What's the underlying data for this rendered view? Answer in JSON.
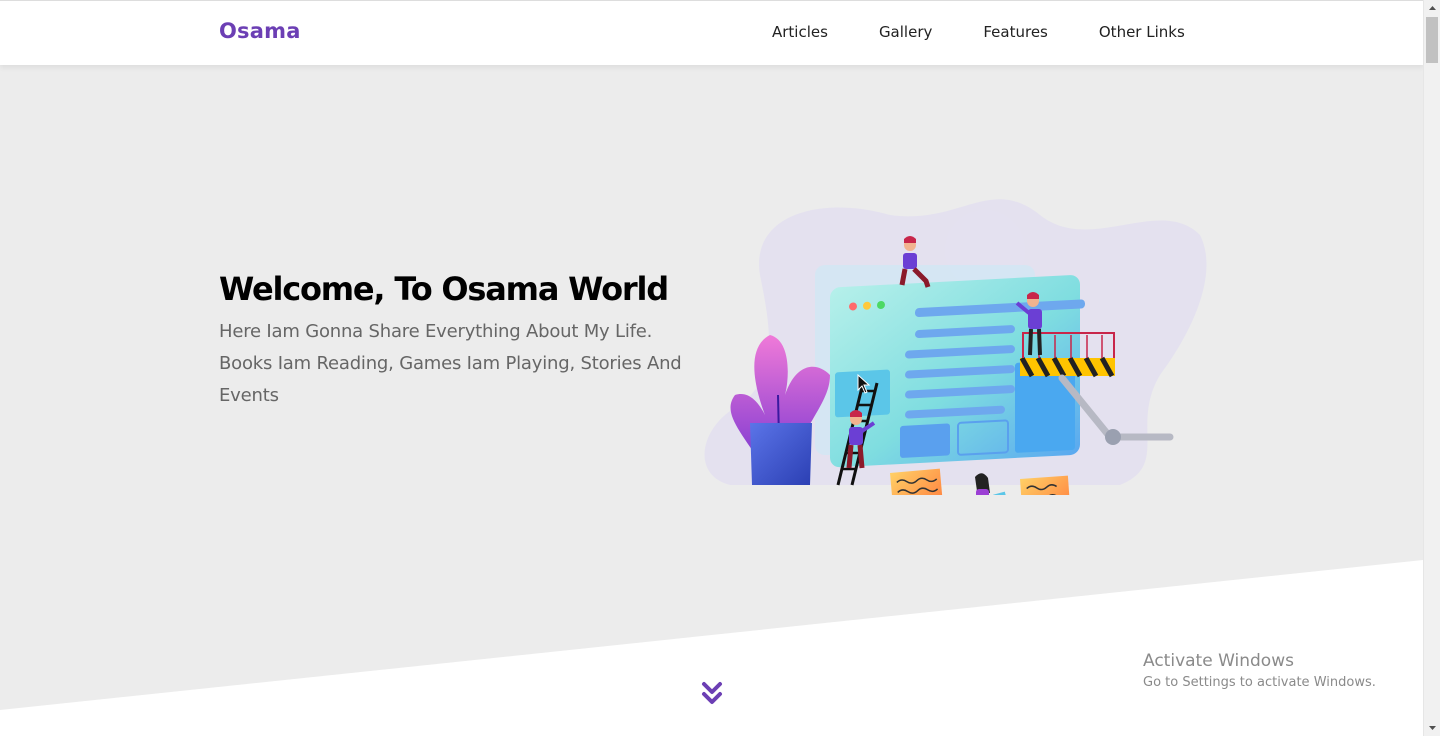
{
  "header": {
    "logo": "Osama",
    "nav": [
      "Articles",
      "Gallery",
      "Features",
      "Other Links"
    ]
  },
  "hero": {
    "title": "Welcome, To Osama World",
    "text": "Here Iam Gonna Share Everything About My Life. Books Iam Reading, Games Iam Playing, Stories And Events"
  },
  "overlay": {
    "activate_title": "Activate Windows",
    "activate_sub": "Go to Settings to activate Windows."
  },
  "colors": {
    "brand": "#6c3fb4",
    "hero_bg": "#ececec",
    "text": "#000000",
    "muted": "#666666"
  },
  "icons": {
    "scroll_down": "double-chevron-down-icon",
    "scroll_up": "scroll-up-arrow-icon",
    "scroll_down_arrow": "scroll-down-arrow-icon"
  }
}
